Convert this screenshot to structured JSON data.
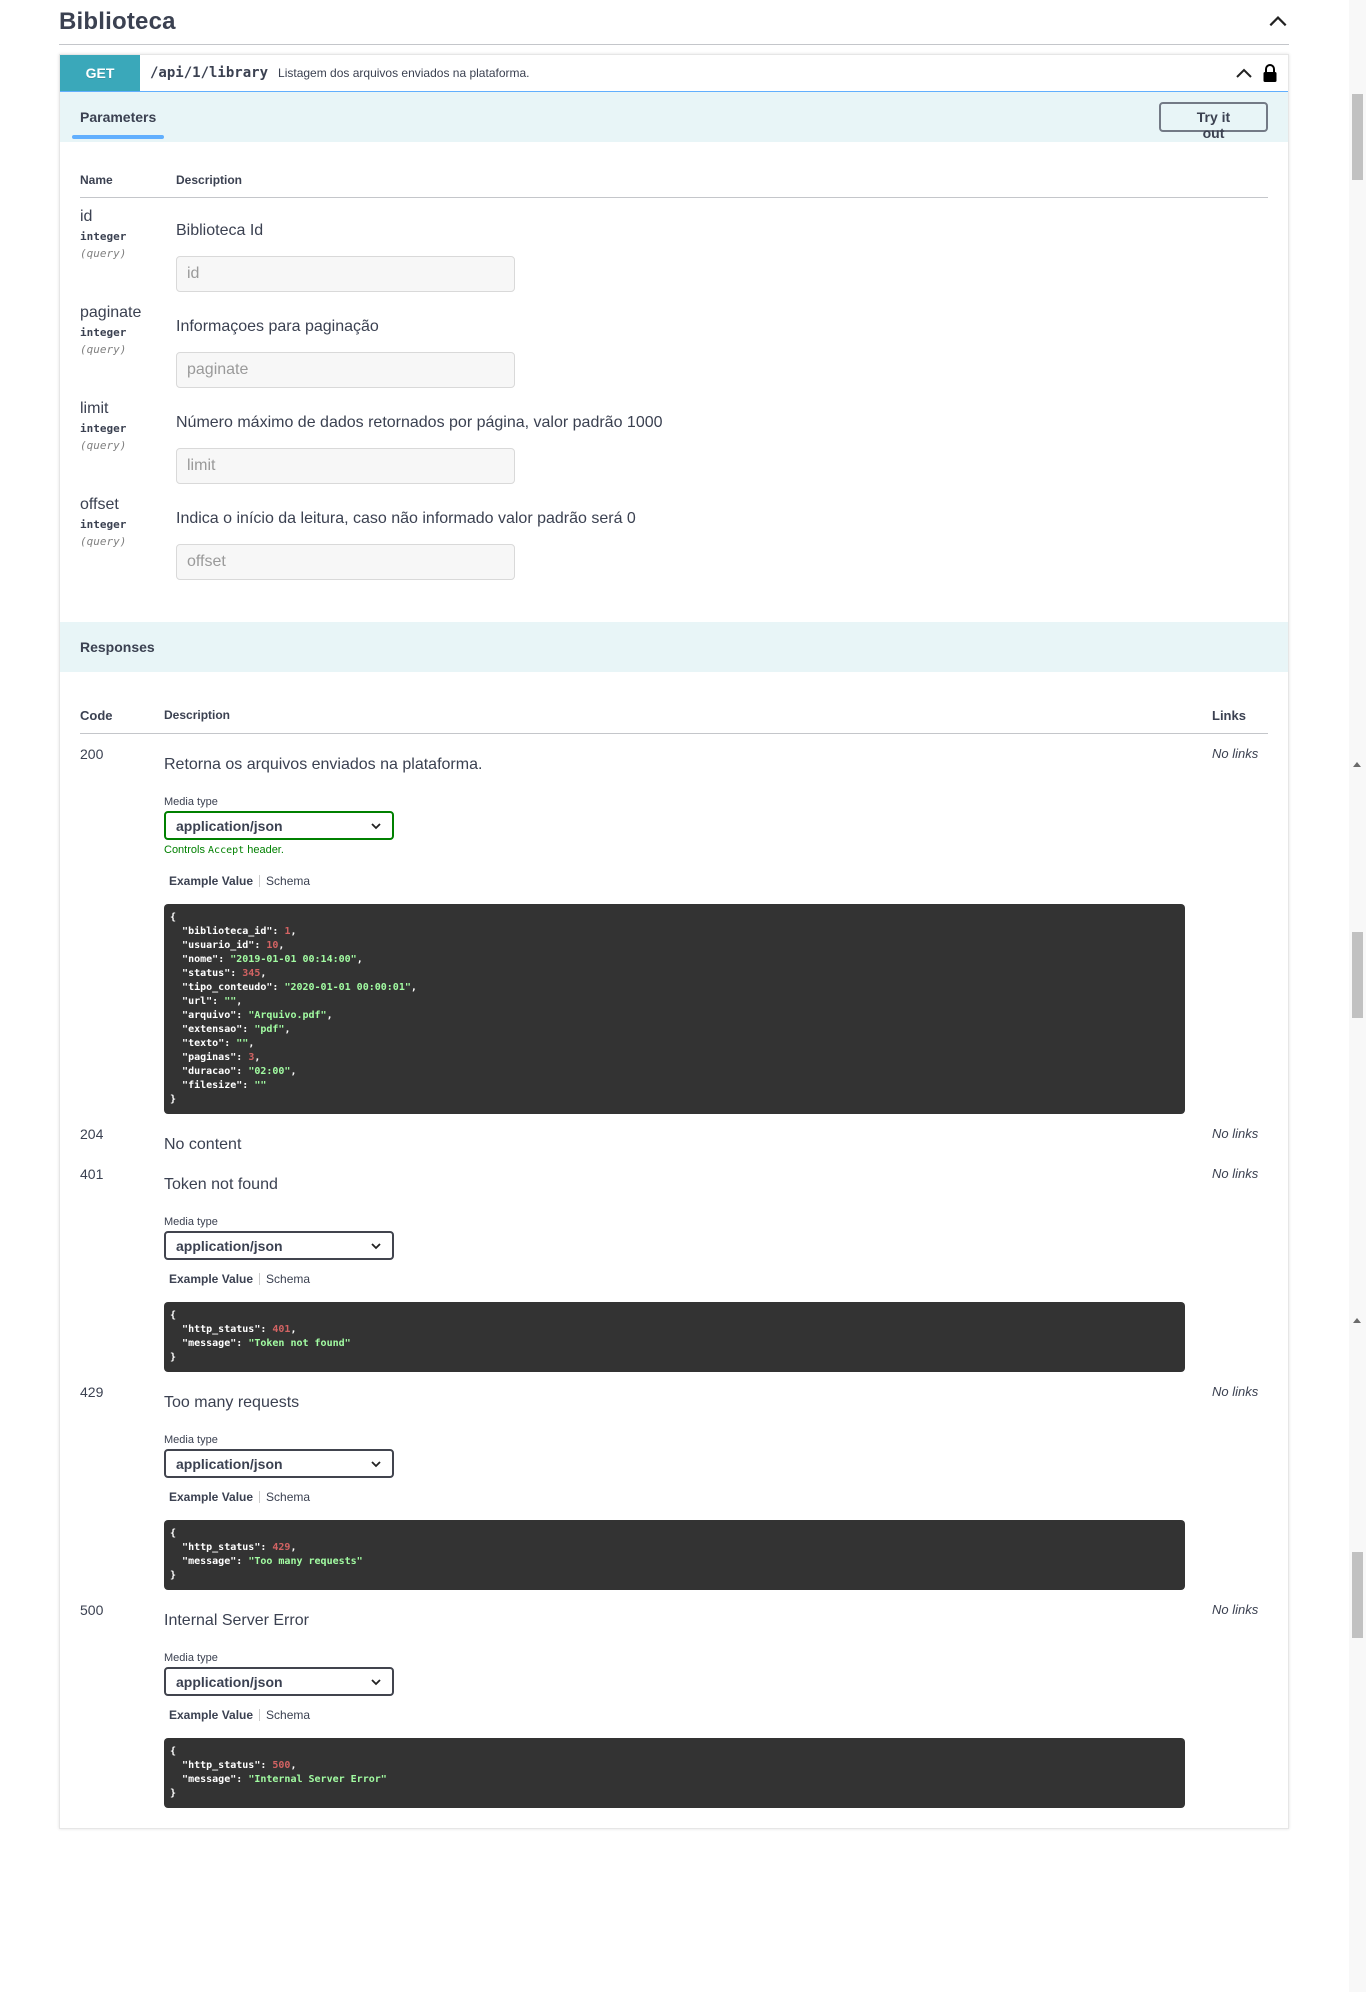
{
  "section": {
    "title": "Biblioteca",
    "collapse_icon": "chevron-up-icon"
  },
  "operation": {
    "method": "GET",
    "path": "/api/1/library",
    "summary": "Listagem dos arquivos enviados na plataforma.",
    "icons": [
      "chevron-up-icon",
      "lock-icon"
    ]
  },
  "parameters": {
    "tab_label": "Parameters",
    "try_button": "Try it out",
    "col_name": "Name",
    "col_description": "Description",
    "items": [
      {
        "name": "id",
        "type": "integer",
        "in": "(query)",
        "description": "Biblioteca Id",
        "placeholder": "id"
      },
      {
        "name": "paginate",
        "type": "integer",
        "in": "(query)",
        "description": "Informaçoes para paginação",
        "placeholder": "paginate"
      },
      {
        "name": "limit",
        "type": "integer",
        "in": "(query)",
        "description": "Número máximo de dados retornados por página, valor padrão 1000",
        "placeholder": "limit"
      },
      {
        "name": "offset",
        "type": "integer",
        "in": "(query)",
        "description": "Indica o início da leitura, caso não informado valor padrão será 0",
        "placeholder": "offset"
      }
    ]
  },
  "responses": {
    "title": "Responses",
    "col_code": "Code",
    "col_description": "Description",
    "col_links": "Links",
    "media_label": "Media type",
    "media_value": "application/json",
    "controls_prefix": "Controls",
    "controls_code": "Accept",
    "controls_suffix": "header.",
    "tab_example": "Example Value",
    "tab_schema": "Schema",
    "no_links": "No links",
    "items": [
      {
        "code": "200",
        "description": "Retorna os arquivos enviados na plataforma.",
        "example": [
          {
            "key": "biblioteca_id",
            "value": "1",
            "kind": "number"
          },
          {
            "key": "usuario_id",
            "value": "10",
            "kind": "number"
          },
          {
            "key": "nome",
            "value": "\"2019-01-01 00:14:00\"",
            "kind": "string"
          },
          {
            "key": "status",
            "value": "345",
            "kind": "number"
          },
          {
            "key": "tipo_conteudo",
            "value": "\"2020-01-01 00:00:01\"",
            "kind": "string"
          },
          {
            "key": "url",
            "value": "\"\"",
            "kind": "string"
          },
          {
            "key": "arquivo",
            "value": "\"Arquivo.pdf\"",
            "kind": "string"
          },
          {
            "key": "extensao",
            "value": "\"pdf\"",
            "kind": "string"
          },
          {
            "key": "texto",
            "value": "\"\"",
            "kind": "string"
          },
          {
            "key": "paginas",
            "value": "3",
            "kind": "number"
          },
          {
            "key": "duracao",
            "value": "\"02:00\"",
            "kind": "string"
          },
          {
            "key": "filesize",
            "value": "\"\"",
            "kind": "string"
          }
        ]
      },
      {
        "code": "204",
        "description": "No content"
      },
      {
        "code": "401",
        "description": "Token not found",
        "example": [
          {
            "key": "http_status",
            "value": "401",
            "kind": "number"
          },
          {
            "key": "message",
            "value": "\"Token not found\"",
            "kind": "string"
          }
        ]
      },
      {
        "code": "429",
        "description": "Too many requests",
        "example": [
          {
            "key": "http_status",
            "value": "429",
            "kind": "number"
          },
          {
            "key": "message",
            "value": "\"Too many requests\"",
            "kind": "string"
          }
        ]
      },
      {
        "code": "500",
        "description": "Internal Server Error",
        "example": [
          {
            "key": "http_status",
            "value": "500",
            "kind": "number"
          },
          {
            "key": "message",
            "value": "\"Internal Server Error\"",
            "kind": "string"
          }
        ]
      }
    ]
  },
  "colors": {
    "method_get": "#3aa8ba",
    "section_bg": "#e8f5f7",
    "code_bg": "#333333",
    "accept_green": "#008000"
  }
}
